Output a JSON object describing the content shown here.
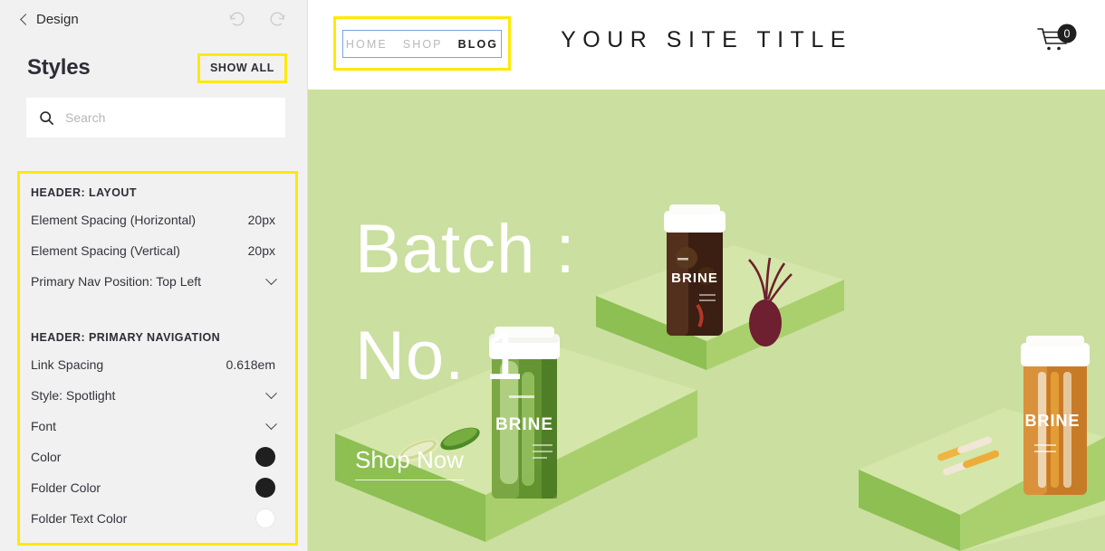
{
  "sidebar": {
    "back_label": "Design",
    "undo_icon": "undo-icon",
    "redo_icon": "redo-icon",
    "panel_title": "Styles",
    "show_all_label": "SHOW ALL",
    "search": {
      "placeholder": "Search",
      "value": "",
      "icon": "search-icon"
    },
    "groups": [
      {
        "heading": "HEADER: LAYOUT",
        "rows": [
          {
            "label": "Element Spacing (Horizontal)",
            "value": "20px",
            "control": "value"
          },
          {
            "label": "Element Spacing (Vertical)",
            "value": "20px",
            "control": "value"
          },
          {
            "label": "Primary Nav Position: Top Left",
            "value": "",
            "control": "chevron"
          }
        ]
      },
      {
        "heading": "HEADER: PRIMARY NAVIGATION",
        "rows": [
          {
            "label": "Link Spacing",
            "value": "0.618em",
            "control": "value"
          },
          {
            "label": "Style: Spotlight",
            "value": "",
            "control": "chevron"
          },
          {
            "label": "Font",
            "value": "",
            "control": "chevron"
          },
          {
            "label": "Color",
            "value": "#1f1f1f",
            "control": "swatch"
          },
          {
            "label": "Folder Color",
            "value": "#1f1f1f",
            "control": "swatch"
          },
          {
            "label": "Folder Text Color",
            "value": "#ffffff",
            "control": "swatch"
          }
        ]
      }
    ]
  },
  "preview": {
    "nav_links": [
      {
        "label": "HOME",
        "active": false
      },
      {
        "label": "SHOP",
        "active": false
      },
      {
        "label": "BLOG",
        "active": true
      }
    ],
    "site_title": "YOUR SITE TITLE",
    "cart": {
      "icon": "shopping-cart-icon",
      "count": "0"
    },
    "hero": {
      "headline_line1": "Batch :",
      "headline_line2": "No. 1",
      "cta_label": "Shop Now",
      "background_color": "#cbdfa0",
      "image_alt": "brine-jars-on-pedestals"
    }
  },
  "colors": {
    "highlight_yellow": "#ffe900",
    "selection_blue": "#7aa5dd",
    "sidebar_bg": "#f1f1f1",
    "hero_green": "#cbdfa0"
  }
}
